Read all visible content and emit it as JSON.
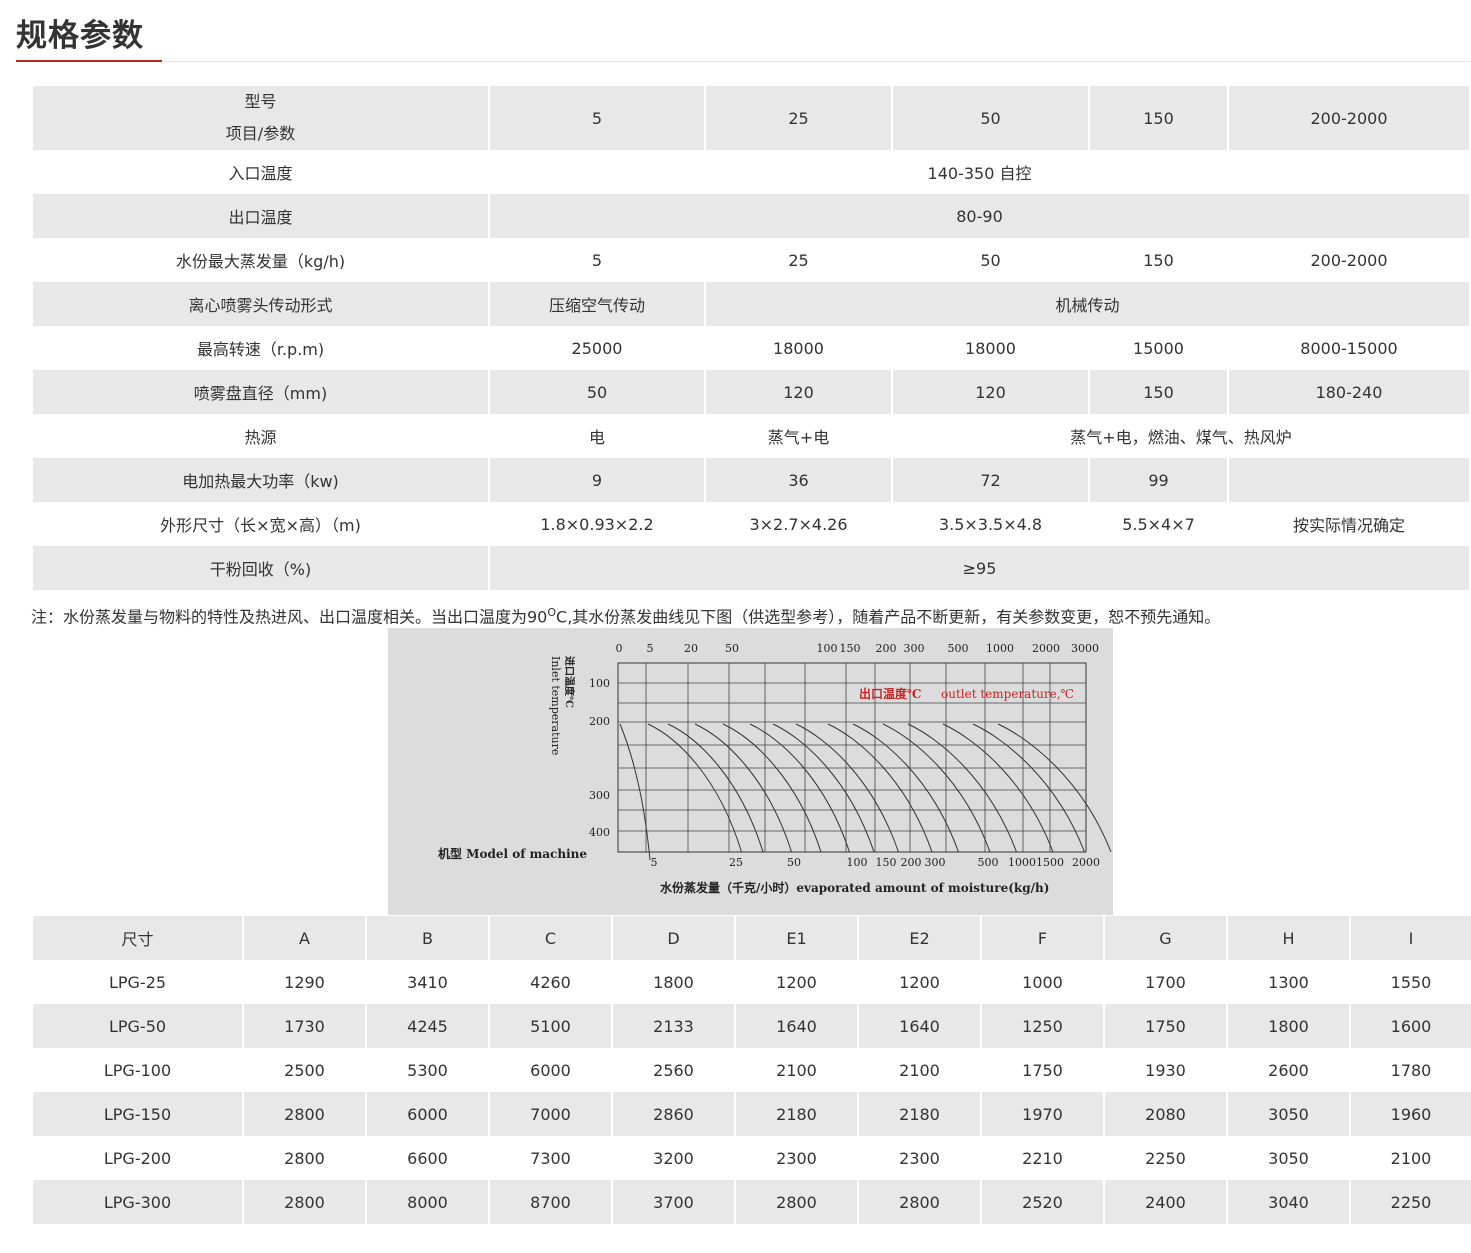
{
  "section": {
    "title": "规格参数"
  },
  "spec_table": {
    "header": {
      "label_line1": "型号",
      "label_line2": "项目/参数",
      "models": [
        "5",
        "25",
        "50",
        "150",
        "200-2000"
      ]
    },
    "rows": [
      {
        "label": "入口温度",
        "cells": [
          {
            "text": "140-350 自控",
            "span": 5
          }
        ]
      },
      {
        "label": "出口温度",
        "cells": [
          {
            "text": "80-90",
            "span": 5
          }
        ]
      },
      {
        "label": "水份最大蒸发量（kg/h)",
        "cells": [
          {
            "text": "5",
            "span": 1
          },
          {
            "text": "25",
            "span": 1
          },
          {
            "text": "50",
            "span": 1
          },
          {
            "text": "150",
            "span": 1
          },
          {
            "text": "200-2000",
            "span": 1
          }
        ]
      },
      {
        "label": "离心喷雾头传动形式",
        "cells": [
          {
            "text": "压缩空气传动",
            "span": 1
          },
          {
            "text": "机械传动",
            "span": 4
          }
        ]
      },
      {
        "label": "最高转速（r.p.m)",
        "cells": [
          {
            "text": "25000",
            "span": 1
          },
          {
            "text": "18000",
            "span": 1
          },
          {
            "text": "18000",
            "span": 1
          },
          {
            "text": "15000",
            "span": 1
          },
          {
            "text": "8000-15000",
            "span": 1
          }
        ]
      },
      {
        "label": "喷雾盘直径（mm)",
        "cells": [
          {
            "text": "50",
            "span": 1
          },
          {
            "text": "120",
            "span": 1
          },
          {
            "text": "120",
            "span": 1
          },
          {
            "text": "150",
            "span": 1
          },
          {
            "text": "180-240",
            "span": 1
          }
        ]
      },
      {
        "label": "热源",
        "cells": [
          {
            "text": "电",
            "span": 1
          },
          {
            "text": "蒸气+电",
            "span": 1
          },
          {
            "text": "蒸气+电，燃油、煤气、热风炉",
            "span": 3
          }
        ]
      },
      {
        "label": "电加热最大功率（kw)",
        "cells": [
          {
            "text": "9",
            "span": 1
          },
          {
            "text": "36",
            "span": 1
          },
          {
            "text": "72",
            "span": 1
          },
          {
            "text": "99",
            "span": 1
          },
          {
            "text": "",
            "span": 1
          }
        ]
      },
      {
        "label": "外形尺寸（长×宽×高）（m)",
        "cells": [
          {
            "text": "1.8×0.93×2.2",
            "span": 1
          },
          {
            "text": "3×2.7×4.26",
            "span": 1
          },
          {
            "text": "3.5×3.5×4.8",
            "span": 1
          },
          {
            "text": "5.5×4×7",
            "span": 1
          },
          {
            "text": "按实际情况确定",
            "span": 1
          }
        ]
      },
      {
        "label": "干粉回收（%)",
        "cells": [
          {
            "text": "≥95",
            "span": 5
          }
        ]
      }
    ]
  },
  "note": {
    "before": "注：水份蒸发量与物料的特性及热进风、出口温度相关。当出口温度为90",
    "sup": "O",
    "after": "C,其水份蒸发曲线见下图（供选型参考），随着产品不断更新，有关参数变更，恕不预先通知。"
  },
  "figure": {
    "ylabel_cn": "进口温度℃",
    "ylabel_en": "Inlet temperature",
    "y_ticks": [
      "100",
      "200",
      "300",
      "400"
    ],
    "top_ticks": [
      "0",
      "5",
      "20",
      "50",
      "100",
      "150",
      "200",
      "300",
      "500",
      "1000",
      "2000",
      "3000"
    ],
    "bottom_ticks": [
      "5",
      "25",
      "50",
      "100",
      "150",
      "200",
      "300",
      "500",
      "1000",
      "1500",
      "2000"
    ],
    "legend_cn": "出口温度℃",
    "legend_en": "outlet temperature,℃",
    "model_label": "机型  Model of machine",
    "xlabel": "水份蒸发量（千克/小时）evaporated amount of moisture(kg/h)",
    "colors": {
      "legend": "#cc2222",
      "lines": "#333333",
      "background": "#dcdcdc"
    }
  },
  "dim_table": {
    "header": [
      "尺寸",
      "A",
      "B",
      "C",
      "D",
      "E1",
      "E2",
      "F",
      "G",
      "H",
      "I"
    ],
    "rows": [
      [
        "LPG-25",
        "1290",
        "3410",
        "4260",
        "1800",
        "1200",
        "1200",
        "1000",
        "1700",
        "1300",
        "1550"
      ],
      [
        "LPG-50",
        "1730",
        "4245",
        "5100",
        "2133",
        "1640",
        "1640",
        "1250",
        "1750",
        "1800",
        "1600"
      ],
      [
        "LPG-100",
        "2500",
        "5300",
        "6000",
        "2560",
        "2100",
        "2100",
        "1750",
        "1930",
        "2600",
        "1780"
      ],
      [
        "LPG-150",
        "2800",
        "6000",
        "7000",
        "2860",
        "2180",
        "2180",
        "1970",
        "2080",
        "3050",
        "1960"
      ],
      [
        "LPG-200",
        "2800",
        "6600",
        "7300",
        "3200",
        "2300",
        "2300",
        "2210",
        "2250",
        "3050",
        "2100"
      ],
      [
        "LPG-300",
        "2800",
        "8000",
        "8700",
        "3700",
        "2800",
        "2800",
        "2520",
        "2400",
        "3040",
        "2250"
      ]
    ]
  }
}
